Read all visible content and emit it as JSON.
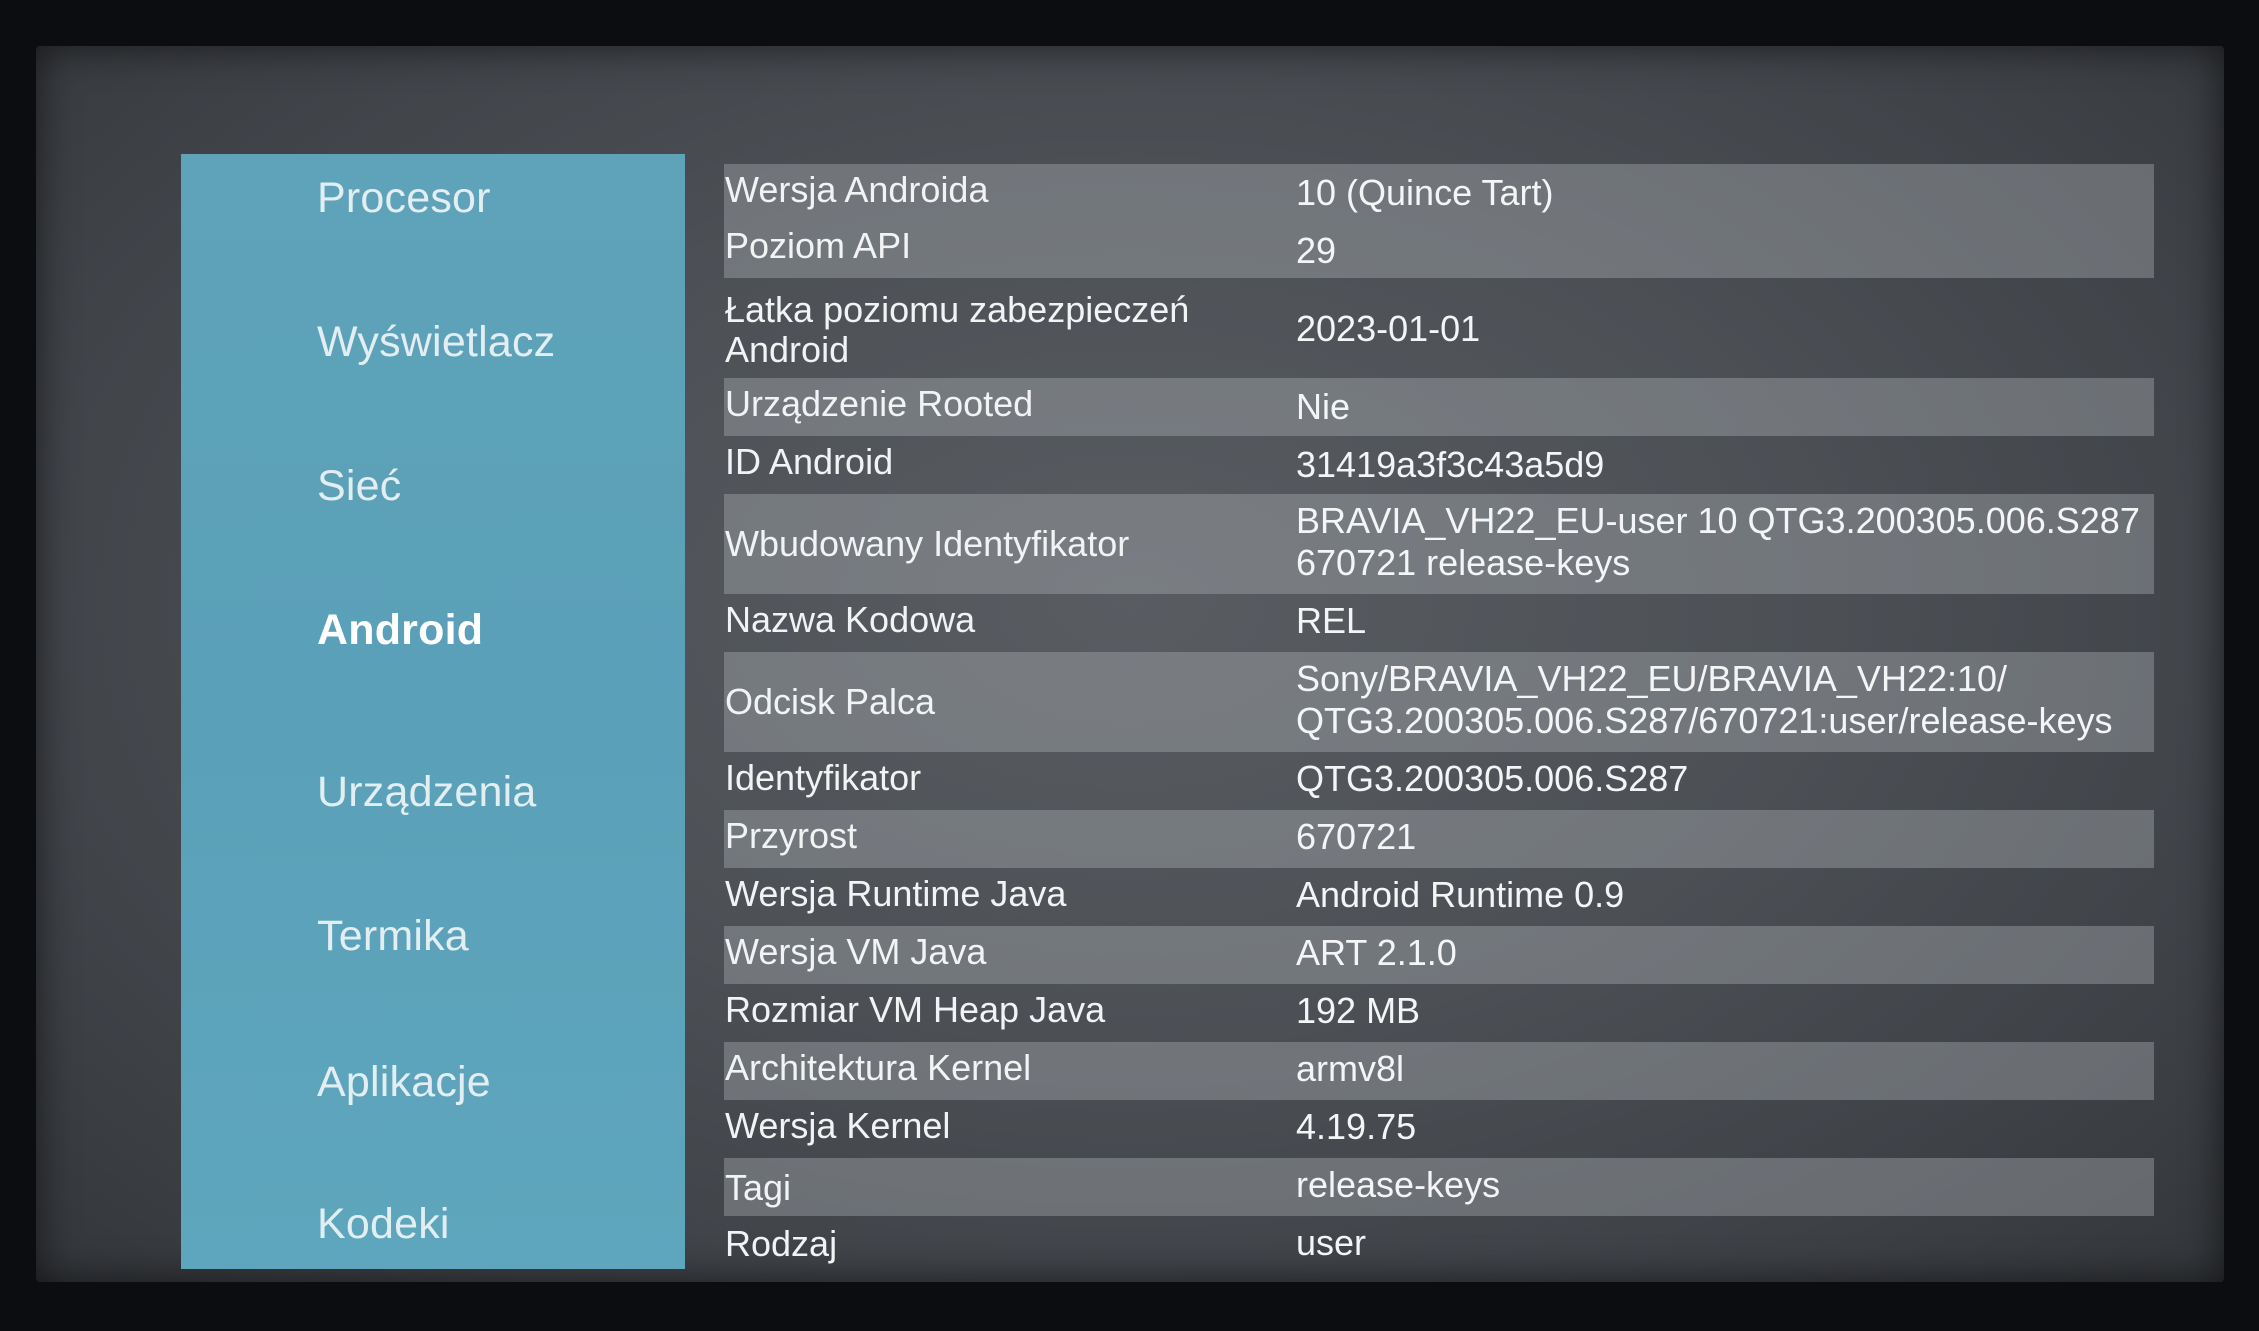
{
  "sidebar": {
    "items": [
      {
        "label": "Procesor"
      },
      {
        "label": "Wyświetlacz"
      },
      {
        "label": "Sieć"
      },
      {
        "label": "Android"
      },
      {
        "label": "Urządzenia"
      },
      {
        "label": "Termika"
      },
      {
        "label": "Aplikacje"
      },
      {
        "label": "Kodeki"
      }
    ],
    "selected": "Android"
  },
  "info": {
    "rows": [
      {
        "label": "Wersja Androida",
        "value": "10 (Quince Tart)"
      },
      {
        "label": "Poziom API",
        "value": "29"
      },
      {
        "label": "Łatka poziomu zabezpieczeń Android",
        "value": "2023-01-01"
      },
      {
        "label": "Urządzenie Rooted",
        "value": "Nie"
      },
      {
        "label": "ID Android",
        "value": "31419a3f3c43a5d9"
      },
      {
        "label": "Wbudowany Identyfikator",
        "value": "BRAVIA_VH22_EU-user 10 QTG3.200305.006.S287 670721 release-keys"
      },
      {
        "label": "Nazwa Kodowa",
        "value": "REL"
      },
      {
        "label": "Odcisk Palca",
        "value": "Sony/BRAVIA_VH22_EU/BRAVIA_VH22:10/ QTG3.200305.006.S287/670721:user/release-keys"
      },
      {
        "label": "Identyfikator",
        "value": "QTG3.200305.006.S287"
      },
      {
        "label": "Przyrost",
        "value": "670721"
      },
      {
        "label": "Wersja Runtime Java",
        "value": "Android Runtime 0.9"
      },
      {
        "label": "Wersja VM Java",
        "value": "ART 2.1.0"
      },
      {
        "label": "Rozmiar VM Heap Java",
        "value": "192 MB"
      },
      {
        "label": "Architektura Kernel",
        "value": "armv8l"
      },
      {
        "label": "Wersja Kernel",
        "value": "4.19.75"
      },
      {
        "label": "Tagi",
        "value": "release-keys"
      },
      {
        "label": "Rodzaj",
        "value": "user"
      }
    ]
  }
}
